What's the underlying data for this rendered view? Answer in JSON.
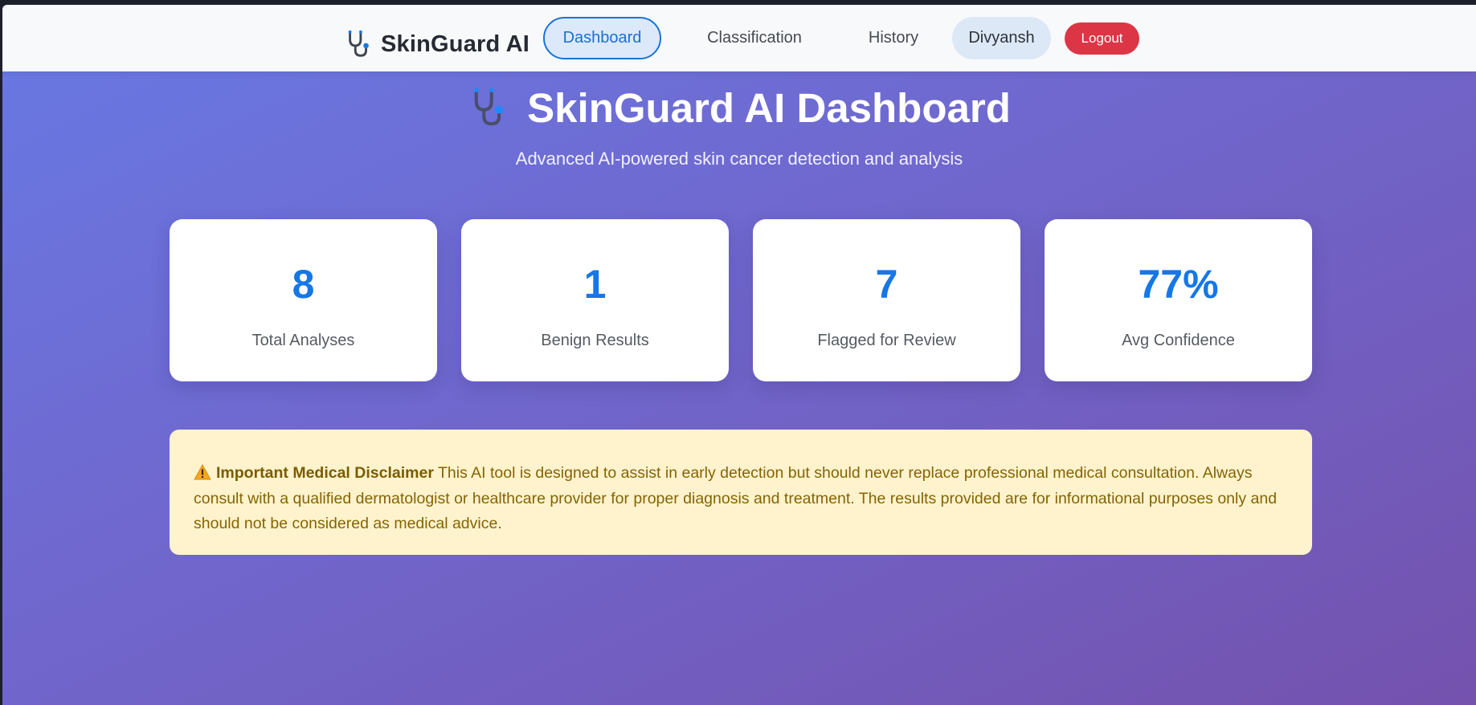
{
  "navbar": {
    "brand": "SkinGuard AI",
    "brand_icon": "stethoscope-icon",
    "items": [
      {
        "label": "Dashboard",
        "active": true
      },
      {
        "label": "Classification",
        "active": false
      },
      {
        "label": "History",
        "active": false
      }
    ],
    "user": "Divyansh",
    "logout_label": "Logout"
  },
  "hero": {
    "icon": "stethoscope-icon",
    "title": "SkinGuard AI Dashboard",
    "subtitle": "Advanced AI-powered skin cancer detection and analysis"
  },
  "stats": [
    {
      "value": "8",
      "label": "Total Analyses"
    },
    {
      "value": "1",
      "label": "Benign Results"
    },
    {
      "value": "7",
      "label": "Flagged for Review"
    },
    {
      "value": "77%",
      "label": "Avg Confidence"
    }
  ],
  "disclaimer": {
    "icon": "warning-icon",
    "title": "Important Medical Disclaimer",
    "text": " This AI tool is designed to assist in early detection but should never replace professional medical consultation. Always consult with a qualified dermatologist or healthcare provider for proper diagnosis and treatment. The results provided are for informational purposes only and should not be considered as medical advice."
  },
  "colors": {
    "accent": "#1677e6",
    "logout": "#dc3545",
    "disclaimer_bg": "#fff3cd",
    "disclaimer_text": "#856404",
    "gradient_start": "#6879e4",
    "gradient_end": "#7452ae"
  }
}
